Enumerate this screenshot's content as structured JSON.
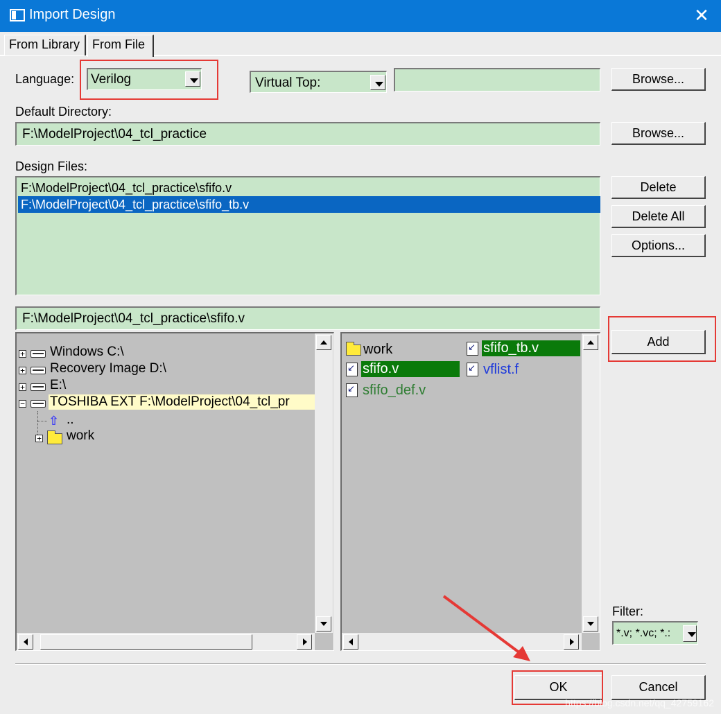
{
  "window": {
    "title": "Import Design",
    "close_glyph": "✕"
  },
  "tabs": [
    {
      "label": "From Library",
      "active": false
    },
    {
      "label": "From File",
      "active": true
    }
  ],
  "language": {
    "label": "Language:",
    "value": "Verilog"
  },
  "virtual_top": {
    "label": "Virtual Top:",
    "value": ""
  },
  "browse_top_label": "Browse...",
  "default_directory": {
    "label": "Default Directory:",
    "value": "F:\\ModelProject\\04_tcl_practice",
    "browse_label": "Browse..."
  },
  "design_files": {
    "label": "Design Files:",
    "items": [
      {
        "path": "F:\\ModelProject\\04_tcl_practice\\sfifo.v",
        "selected": false
      },
      {
        "path": "F:\\ModelProject\\04_tcl_practice\\sfifo_tb.v",
        "selected": true
      }
    ],
    "buttons": {
      "delete": "Delete",
      "delete_all": "Delete All",
      "options": "Options..."
    }
  },
  "current_path": "F:\\ModelProject\\04_tcl_practice\\sfifo.v",
  "add_label": "Add",
  "tree": [
    {
      "label": "Windows C:\\",
      "icon": "drive-icon",
      "expander": "+"
    },
    {
      "label": "Recovery Image D:\\",
      "icon": "drive-icon",
      "expander": "+"
    },
    {
      "label": "E:\\",
      "icon": "drive-icon",
      "expander": "+"
    },
    {
      "label": "TOSHIBA EXT F:\\ModelProject\\04_tcl_pr",
      "icon": "drive-icon",
      "expander": "−",
      "highlighted": true
    },
    {
      "label": "..",
      "icon": "up-arrow-icon"
    },
    {
      "label": "work",
      "icon": "folder-icon",
      "expander": "+"
    }
  ],
  "files": [
    {
      "name": "work",
      "type": "folder"
    },
    {
      "name": "sfifo_tb.v",
      "type": "verilog",
      "selected": true
    },
    {
      "name": "sfifo.v",
      "type": "verilog",
      "selected": true
    },
    {
      "name": "vflist.f",
      "type": "filelist"
    },
    {
      "name": "sfifo_def.v",
      "type": "verilog"
    }
  ],
  "filter": {
    "label": "Filter:",
    "value": "*.v; *.vc; *.:"
  },
  "ok_label": "OK",
  "cancel_label": "Cancel",
  "watermark": "https://blog.csdn.net/qq_42759162",
  "colors": {
    "titlebar": "#0a78d7",
    "field_green": "#c8e6c9",
    "selection_blue": "#0a66c2",
    "selection_green": "#0a7a0a",
    "annotation_red": "#e53935"
  }
}
